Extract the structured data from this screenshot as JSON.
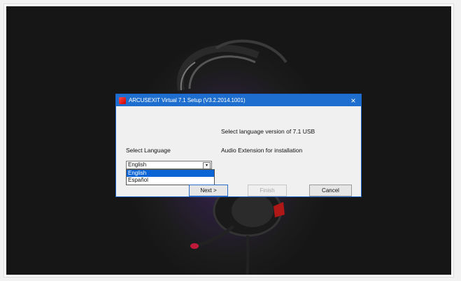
{
  "dialog": {
    "title": "ARCUSEXIT Virtual 7.1 Setup (V3.2.2014.1001)",
    "close_glyph": "×",
    "prompt_line1": "Select language version of 7.1 USB",
    "prompt_line2": "Audio Extension for installation",
    "select_label": "Select Language",
    "combo_value": "English",
    "combo_arrow": "▾",
    "options": [
      "English",
      "Español"
    ],
    "next_label": "Next >",
    "finish_label": "Finish",
    "cancel_label": "Cancel"
  },
  "icons": {
    "app": "app-icon",
    "close": "close-icon",
    "dropdown_arrow": "chevron-down-icon"
  },
  "colors": {
    "titlebar": "#1e6ecf",
    "selection": "#0a64d6",
    "background_glow": "#4a2a6a"
  }
}
